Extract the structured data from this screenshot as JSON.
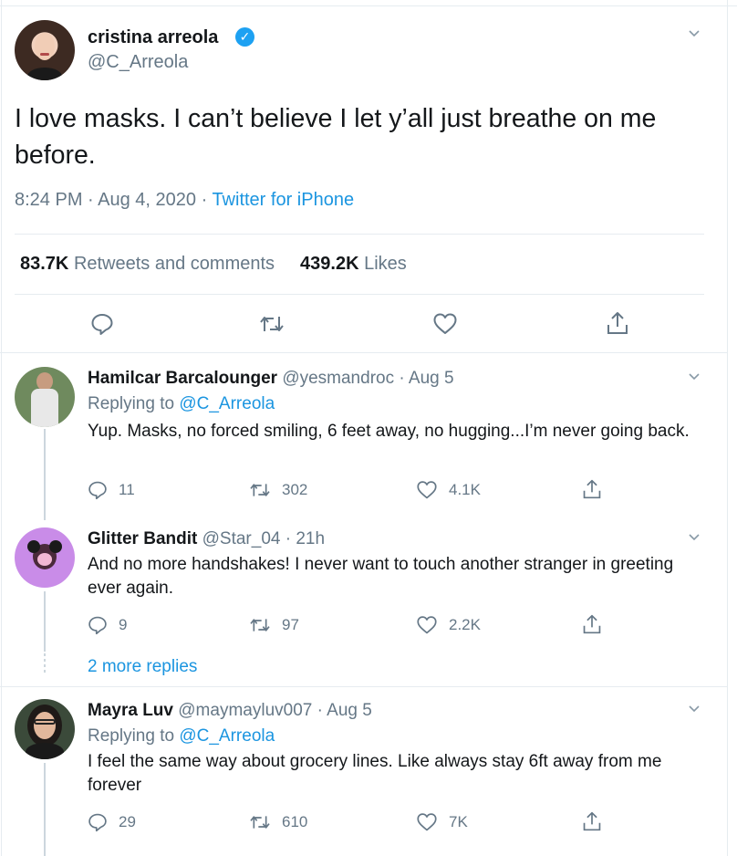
{
  "main_tweet": {
    "name": "cristina arreola",
    "handle": "@C_Arreola",
    "text": "I love masks. I can’t believe I let y’all just breathe on me before.",
    "time": "8:24 PM · Aug 4, 2020 · ",
    "source": "Twitter for iPhone",
    "retweets_count": "83.7K",
    "retweets_label": "Retweets and comments",
    "likes_count": "439.2K",
    "likes_label": "Likes"
  },
  "replies": [
    {
      "name": "Hamilcar Barcalounger",
      "handle_date": "@yesmandroc · Aug 5",
      "replying_prefix": "Replying to ",
      "replying_to": "@C_Arreola",
      "text": "Yup. Masks, no forced smiling, 6 feet away, no hugging...I’m never going back.",
      "replies": "11",
      "retweets": "302",
      "likes": "4.1K"
    },
    {
      "name": "Glitter Bandit",
      "handle_date": "@Star_04 · 21h",
      "text": "And no more handshakes! I never want to touch another stranger in greeting ever again.",
      "replies": "9",
      "retweets": "97",
      "likes": "2.2K"
    },
    {
      "name": "Mayra Luv",
      "handle_date": "@maymayluv007 · Aug 5",
      "replying_prefix": "Replying to ",
      "replying_to": "@C_Arreola",
      "text": "I feel the same way about grocery lines. Like always stay 6ft away from me forever",
      "replies": "29",
      "retweets": "610",
      "likes": "7K"
    }
  ],
  "more_replies": "2 more replies",
  "colors": {
    "text": "#14171a",
    "muted": "#657786",
    "link": "#1b95e0",
    "verified": "#1da1f2",
    "border": "#e6ecf0"
  },
  "icons": [
    "verified-badge-icon",
    "chevron-down-icon",
    "reply-icon",
    "retweet-icon",
    "like-icon",
    "share-icon"
  ]
}
